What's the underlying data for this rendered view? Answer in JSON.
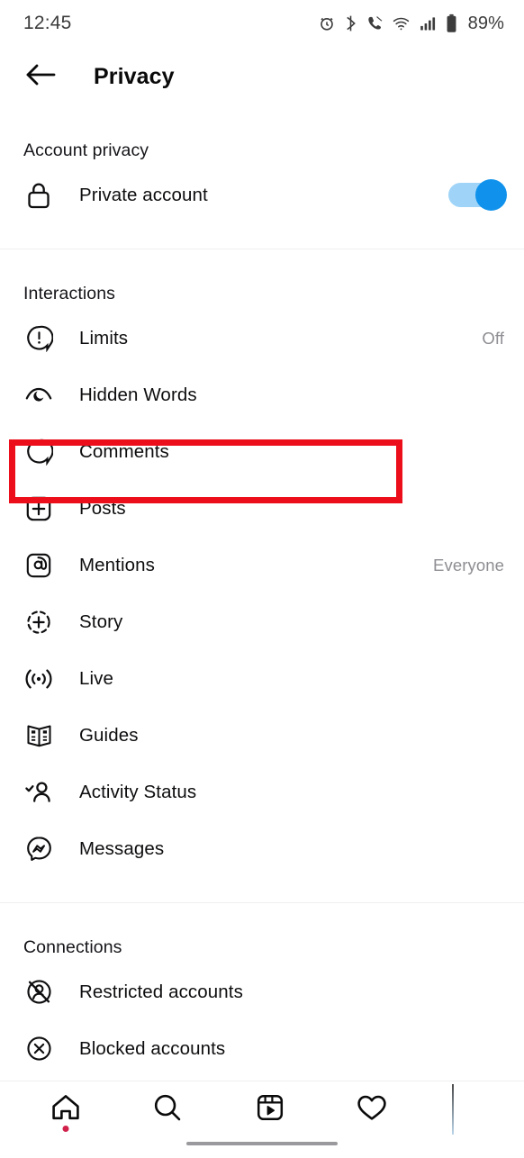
{
  "status_bar": {
    "time": "12:45",
    "battery_percent": "89%",
    "icons": [
      "alarm-icon",
      "bluetooth-icon",
      "call-mute-icon",
      "wifi-icon",
      "cellular-signal-icon",
      "battery-icon"
    ]
  },
  "header": {
    "title": "Privacy",
    "back_icon": "arrow-left-icon"
  },
  "sections": [
    {
      "title": "Account privacy",
      "rows": [
        {
          "label": "Private account",
          "icon": "lock-icon",
          "value": "",
          "control": "toggle",
          "toggle_on": true
        }
      ]
    },
    {
      "title": "Interactions",
      "rows": [
        {
          "label": "Limits",
          "icon": "comment-alert-icon",
          "value": "Off",
          "control": "value"
        },
        {
          "label": "Hidden Words",
          "icon": "eye-moon-icon",
          "value": "",
          "control": "none"
        },
        {
          "label": "Comments",
          "icon": "comment-bubble-icon",
          "value": "",
          "control": "none",
          "highlighted": true
        },
        {
          "label": "Posts",
          "icon": "plus-square-icon",
          "value": "",
          "control": "none"
        },
        {
          "label": "Mentions",
          "icon": "at-square-icon",
          "value": "Everyone",
          "control": "value"
        },
        {
          "label": "Story",
          "icon": "story-plus-icon",
          "value": "",
          "control": "none"
        },
        {
          "label": "Live",
          "icon": "live-broadcast-icon",
          "value": "",
          "control": "none"
        },
        {
          "label": "Guides",
          "icon": "guides-book-icon",
          "value": "",
          "control": "none"
        },
        {
          "label": "Activity Status",
          "icon": "person-check-icon",
          "value": "",
          "control": "none"
        },
        {
          "label": "Messages",
          "icon": "messenger-icon",
          "value": "",
          "control": "none"
        }
      ]
    },
    {
      "title": "Connections",
      "rows": [
        {
          "label": "Restricted accounts",
          "icon": "person-slash-icon",
          "value": "",
          "control": "none"
        },
        {
          "label": "Blocked accounts",
          "icon": "x-circle-icon",
          "value": "",
          "control": "none"
        }
      ]
    }
  ],
  "bottom_nav": {
    "items": [
      {
        "name": "home",
        "icon": "home-icon",
        "badge_dot": true
      },
      {
        "name": "search",
        "icon": "search-icon",
        "badge_dot": false
      },
      {
        "name": "reels",
        "icon": "reels-icon",
        "badge_dot": false
      },
      {
        "name": "activity",
        "icon": "heart-icon",
        "badge_dot": false
      },
      {
        "name": "profile",
        "icon": "avatar-icon",
        "badge_dot": false
      }
    ]
  },
  "overlay": {
    "highlight_target": "Comments",
    "highlight_color": "#ec0f1b"
  },
  "colors": {
    "accent_blue": "#1092ec",
    "toggle_track": "#9fd4f8",
    "label_text": "#0e0e10",
    "muted_text": "#8e8e93",
    "divider": "#efeff1",
    "badge_dot": "#d1204a"
  },
  "watermark": {
    "text": ""
  }
}
